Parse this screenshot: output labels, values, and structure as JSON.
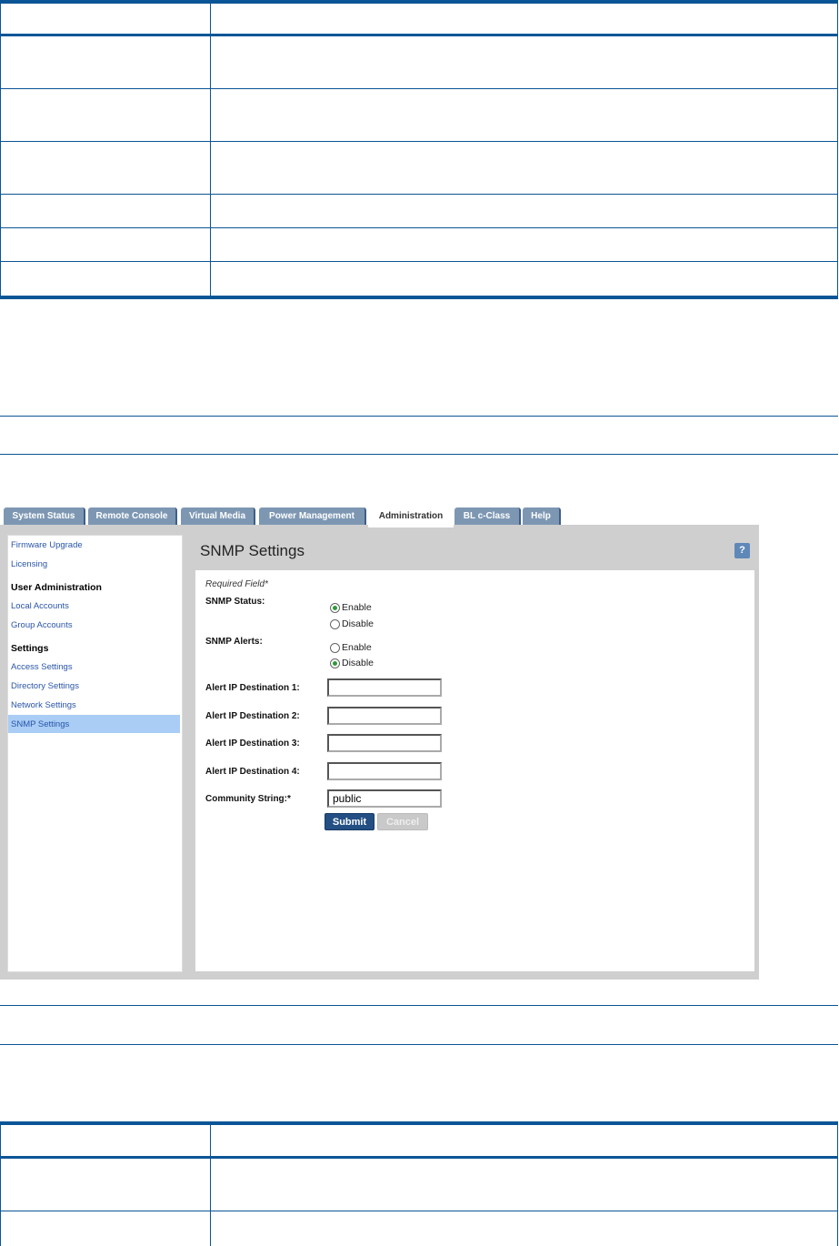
{
  "colors": {
    "rule": "#0a5596",
    "tab": "#7d97b3",
    "selected": "#a9cdf5",
    "submit": "#234f83"
  },
  "tabs": [
    {
      "label": "System Status"
    },
    {
      "label": "Remote Console"
    },
    {
      "label": "Virtual Media"
    },
    {
      "label": "Power Management"
    },
    {
      "label": "Administration",
      "active": true
    },
    {
      "label": "BL c-Class"
    },
    {
      "label": "Help"
    }
  ],
  "sidebar": {
    "items": [
      {
        "label": "Firmware Upgrade",
        "type": "link"
      },
      {
        "label": "Licensing",
        "type": "link"
      },
      {
        "label": "User Administration",
        "type": "heading"
      },
      {
        "label": "Local Accounts",
        "type": "link"
      },
      {
        "label": "Group Accounts",
        "type": "link"
      },
      {
        "label": "Settings",
        "type": "heading"
      },
      {
        "label": "Access Settings",
        "type": "link"
      },
      {
        "label": "Directory Settings",
        "type": "link"
      },
      {
        "label": "Network Settings",
        "type": "link"
      },
      {
        "label": "SNMP Settings",
        "type": "link",
        "selected": true
      }
    ]
  },
  "main": {
    "title": "SNMP Settings",
    "help_icon": "?",
    "required_note": "Required Field*",
    "snmp_status": {
      "label": "SNMP Status:",
      "options": [
        "Enable",
        "Disable"
      ],
      "selected": "Enable"
    },
    "snmp_alerts": {
      "label": "SNMP Alerts:",
      "options": [
        "Enable",
        "Disable"
      ],
      "selected": "Disable"
    },
    "fields": [
      {
        "label": "Alert IP Destination 1:",
        "value": ""
      },
      {
        "label": "Alert IP Destination 2:",
        "value": ""
      },
      {
        "label": "Alert IP Destination 3:",
        "value": ""
      },
      {
        "label": "Alert IP Destination 4:",
        "value": ""
      },
      {
        "label": "Community String:*",
        "value": "public"
      }
    ],
    "submit": "Submit",
    "cancel": "Cancel"
  }
}
